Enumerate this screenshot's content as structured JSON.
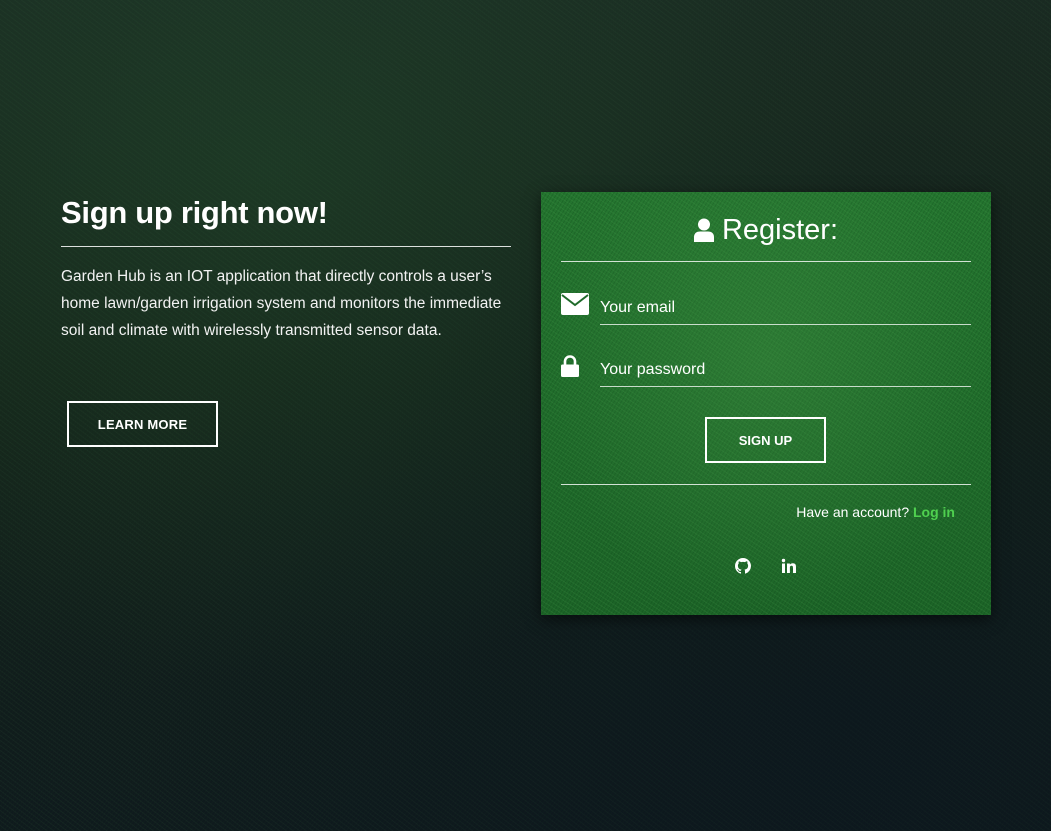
{
  "intro": {
    "title": "Sign up right now!",
    "description": "Garden Hub is an IOT application that directly controls a user’s home lawn/garden irrigation system and monitors the immediate soil and climate with wirelessly transmitted sensor data.",
    "learn_more_label": "LEARN MORE"
  },
  "register": {
    "header_icon": "user-icon",
    "title": "Register:",
    "email_icon": "envelope-icon",
    "email_placeholder": "Your email",
    "email_value": "",
    "password_icon": "lock-icon",
    "password_placeholder": "Your password",
    "password_value": "",
    "signup_label": "SIGN UP",
    "have_account_text": "Have an account?",
    "login_label": "Log in",
    "social": [
      "github-icon",
      "linkedin-icon"
    ]
  },
  "colors": {
    "card_green": "#1f6a2a",
    "login_link": "#4fd04f",
    "text": "#ffffff"
  }
}
